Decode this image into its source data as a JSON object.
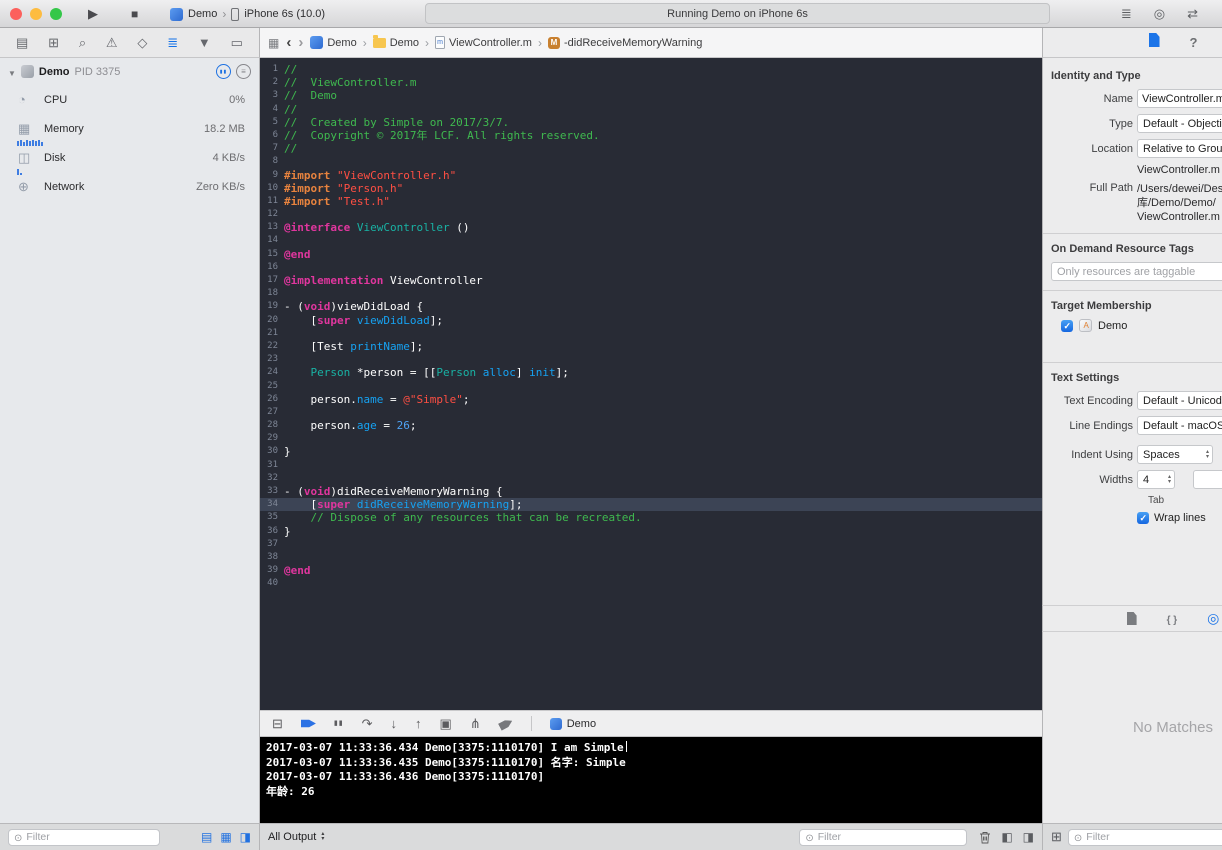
{
  "toolbar": {
    "play_glyph": "▶",
    "stop_glyph": "■",
    "scheme_name": "Demo",
    "scheme_device": "iPhone 6s (10.0)",
    "status_text": "Running Demo on iPhone 6s",
    "editor_buttons": [
      {
        "name": "standard-editor-icon",
        "glyph": "≣"
      },
      {
        "name": "assistant-editor-icon",
        "glyph": "◎"
      },
      {
        "name": "version-editor-icon",
        "glyph": "⇄"
      }
    ]
  },
  "navigator": {
    "tabs": [
      {
        "name": "project-navigator-icon",
        "glyph": "▤",
        "active": false
      },
      {
        "name": "symbol-navigator-icon",
        "glyph": "⊞",
        "active": false
      },
      {
        "name": "search-navigator-icon",
        "glyph": "⌕",
        "active": false
      },
      {
        "name": "issue-navigator-icon",
        "glyph": "⚠",
        "active": false
      },
      {
        "name": "test-navigator-icon",
        "glyph": "◇",
        "active": false
      },
      {
        "name": "debug-navigator-icon",
        "glyph": "≣",
        "active": true
      },
      {
        "name": "breakpoint-navigator-icon",
        "glyph": "▼",
        "active": false
      },
      {
        "name": "report-navigator-icon",
        "glyph": "▭",
        "active": false
      }
    ],
    "process": {
      "name": "Demo",
      "pid": "PID 3375"
    },
    "gauges": [
      {
        "id": "cpu",
        "icon": "cpu-gauge-icon",
        "glyph": "◔",
        "label": "CPU",
        "value": "0%"
      },
      {
        "id": "memory",
        "icon": "memory-gauge-icon",
        "glyph": "▦",
        "label": "Memory",
        "value": "18.2 MB",
        "spark": [
          5,
          6,
          4,
          6,
          5,
          6,
          5,
          6,
          4
        ]
      },
      {
        "id": "disk",
        "icon": "disk-gauge-icon",
        "glyph": "◫",
        "label": "Disk",
        "value": "4 KB/s",
        "spark": [
          6,
          2
        ]
      },
      {
        "id": "network",
        "icon": "network-gauge-icon",
        "glyph": "⊕",
        "label": "Network",
        "value": "Zero KB/s"
      }
    ],
    "filter_placeholder": "Filter",
    "bottom_icons": [
      {
        "name": "gauge-view-icon-1",
        "glyph": "▤"
      },
      {
        "name": "gauge-view-icon-2",
        "glyph": "▦"
      },
      {
        "name": "gauge-view-icon-3",
        "glyph": "◨"
      }
    ]
  },
  "jumpbar": {
    "crumbs": [
      {
        "icon": "project-crumb-icon",
        "label": "Demo",
        "badge": ""
      },
      {
        "icon": "folder-crumb-icon",
        "label": "Demo",
        "badge": ""
      },
      {
        "icon": "file-m-crumb-icon",
        "label": "ViewController.m",
        "badge": "m"
      },
      {
        "icon": "method-crumb-icon",
        "label": "-didReceiveMemoryWarning",
        "badge": "M"
      }
    ]
  },
  "editor": {
    "highlight_line": 34,
    "lines": [
      {
        "n": 1,
        "seg": [
          [
            "c",
            "//"
          ]
        ]
      },
      {
        "n": 2,
        "seg": [
          [
            "c",
            "//  ViewController.m"
          ]
        ]
      },
      {
        "n": 3,
        "seg": [
          [
            "c",
            "//  Demo"
          ]
        ]
      },
      {
        "n": 4,
        "seg": [
          [
            "c",
            "//"
          ]
        ]
      },
      {
        "n": 5,
        "seg": [
          [
            "c",
            "//  Created by Simple on 2017/3/7."
          ]
        ]
      },
      {
        "n": 6,
        "seg": [
          [
            "c",
            "//  Copyright © 2017年 LCF. All rights reserved."
          ]
        ]
      },
      {
        "n": 7,
        "seg": [
          [
            "c",
            "//"
          ]
        ]
      },
      {
        "n": 8,
        "seg": []
      },
      {
        "n": 9,
        "seg": [
          [
            "d",
            "#import"
          ],
          [
            "p",
            " "
          ],
          [
            "s",
            "\"ViewController.h\""
          ]
        ]
      },
      {
        "n": 10,
        "seg": [
          [
            "d",
            "#import"
          ],
          [
            "p",
            " "
          ],
          [
            "s",
            "\"Person.h\""
          ]
        ]
      },
      {
        "n": 11,
        "seg": [
          [
            "d",
            "#import"
          ],
          [
            "p",
            " "
          ],
          [
            "s",
            "\"Test.h\""
          ]
        ]
      },
      {
        "n": 12,
        "seg": []
      },
      {
        "n": 13,
        "seg": [
          [
            "k",
            "@interface"
          ],
          [
            "p",
            " "
          ],
          [
            "t",
            "ViewController"
          ],
          [
            "p",
            " ()"
          ]
        ]
      },
      {
        "n": 14,
        "seg": []
      },
      {
        "n": 15,
        "seg": [
          [
            "k",
            "@end"
          ]
        ]
      },
      {
        "n": 16,
        "seg": []
      },
      {
        "n": 17,
        "seg": [
          [
            "k",
            "@implementation"
          ],
          [
            "p",
            " ViewController"
          ]
        ]
      },
      {
        "n": 18,
        "seg": []
      },
      {
        "n": 19,
        "seg": [
          [
            "p",
            "- ("
          ],
          [
            "k",
            "void"
          ],
          [
            "p",
            ")viewDidLoad {"
          ]
        ]
      },
      {
        "n": 20,
        "seg": [
          [
            "p",
            "    ["
          ],
          [
            "k",
            "super"
          ],
          [
            "p",
            " "
          ],
          [
            "m",
            "viewDidLoad"
          ],
          [
            "p",
            "];"
          ]
        ]
      },
      {
        "n": 21,
        "seg": []
      },
      {
        "n": 22,
        "seg": [
          [
            "p",
            "    [Test "
          ],
          [
            "m",
            "printName"
          ],
          [
            "p",
            "];"
          ]
        ]
      },
      {
        "n": 23,
        "seg": []
      },
      {
        "n": 24,
        "seg": [
          [
            "p",
            "    "
          ],
          [
            "t",
            "Person"
          ],
          [
            "p",
            " *person = [["
          ],
          [
            "t",
            "Person"
          ],
          [
            "p",
            " "
          ],
          [
            "m",
            "alloc"
          ],
          [
            "p",
            "] "
          ],
          [
            "m",
            "init"
          ],
          [
            "p",
            "];"
          ]
        ]
      },
      {
        "n": 25,
        "seg": []
      },
      {
        "n": 26,
        "seg": [
          [
            "p",
            "    person."
          ],
          [
            "m",
            "name"
          ],
          [
            "p",
            " = "
          ],
          [
            "s",
            "@\"Simple\""
          ],
          [
            "p",
            ";"
          ]
        ]
      },
      {
        "n": 27,
        "seg": []
      },
      {
        "n": 28,
        "seg": [
          [
            "p",
            "    person."
          ],
          [
            "m",
            "age"
          ],
          [
            "p",
            " = "
          ],
          [
            "n",
            "26"
          ],
          [
            "p",
            ";"
          ]
        ]
      },
      {
        "n": 29,
        "seg": []
      },
      {
        "n": 30,
        "seg": [
          [
            "p",
            "}"
          ]
        ]
      },
      {
        "n": 31,
        "seg": []
      },
      {
        "n": 32,
        "seg": []
      },
      {
        "n": 33,
        "seg": [
          [
            "p",
            "- ("
          ],
          [
            "k",
            "void"
          ],
          [
            "p",
            ")didReceiveMemoryWarning {"
          ]
        ]
      },
      {
        "n": 34,
        "seg": [
          [
            "p",
            "    ["
          ],
          [
            "k",
            "super"
          ],
          [
            "p",
            " "
          ],
          [
            "m",
            "didReceiveMemoryWarning"
          ],
          [
            "p",
            "];"
          ]
        ]
      },
      {
        "n": 35,
        "seg": [
          [
            "c",
            "    // Dispose of any resources that can be recreated."
          ]
        ]
      },
      {
        "n": 36,
        "seg": [
          [
            "p",
            "}"
          ]
        ]
      },
      {
        "n": 37,
        "seg": []
      },
      {
        "n": 38,
        "seg": []
      },
      {
        "n": 39,
        "seg": [
          [
            "k",
            "@end"
          ]
        ]
      },
      {
        "n": 40,
        "seg": []
      }
    ]
  },
  "debugbar": {
    "buttons": [
      {
        "name": "hide-debug-area-icon",
        "glyph": "⊟"
      },
      {
        "name": "breakpoints-toggle-icon",
        "glyph": "",
        "shape": "arrow-blue"
      },
      {
        "name": "pause-icon",
        "glyph": "▮▮"
      },
      {
        "name": "step-over-icon",
        "glyph": "↷"
      },
      {
        "name": "step-into-icon",
        "glyph": "↓"
      },
      {
        "name": "step-out-icon",
        "glyph": "↑"
      },
      {
        "name": "view-hierarchy-icon",
        "glyph": "▣"
      },
      {
        "name": "memory-graph-icon",
        "glyph": "⋔"
      },
      {
        "name": "simulate-location-icon",
        "glyph": "",
        "shape": "arrow-gray"
      }
    ],
    "process_label": "Demo"
  },
  "console": {
    "lines": [
      {
        "text": "2017-03-07 11:33:36.434 Demo[3375:1110170] I am Simple",
        "cursor": true
      },
      {
        "text": "2017-03-07 11:33:36.435 Demo[3375:1110170] 名字: Simple"
      },
      {
        "text": "2017-03-07 11:33:36.436 Demo[3375:1110170]"
      },
      {
        "text": "年龄: 26"
      }
    ],
    "output_selector": "All Output",
    "filter_placeholder": "Filter"
  },
  "inspector": {
    "identity": {
      "header": "Identity and Type",
      "name_label": "Name",
      "name_value": "ViewController.m",
      "type_label": "Type",
      "type_value": "Default - Objecti",
      "location_label": "Location",
      "location_value": "Relative to Group",
      "location_file": "ViewController.m",
      "fullpath_label": "Full Path",
      "fullpath_lines": [
        "/Users/dewei/Des",
        "库/Demo/Demo/",
        "ViewController.m"
      ]
    },
    "resource_tags": {
      "header": "On Demand Resource Tags",
      "placeholder": "Only resources are taggable"
    },
    "target_membership": {
      "header": "Target Membership",
      "target_name": "Demo"
    },
    "text_settings": {
      "header": "Text Settings",
      "encoding_label": "Text Encoding",
      "encoding_value": "Default - Unicod",
      "line_endings_label": "Line Endings",
      "line_endings_value": "Default - macOS",
      "indent_label": "Indent Using",
      "indent_value": "Spaces",
      "widths_label": "Widths",
      "widths_value": "4",
      "tab_caption": "Tab",
      "wrap_label": "Wrap lines"
    },
    "library": {
      "empty_text": "No Matches",
      "filter_placeholder": "Filter"
    }
  }
}
